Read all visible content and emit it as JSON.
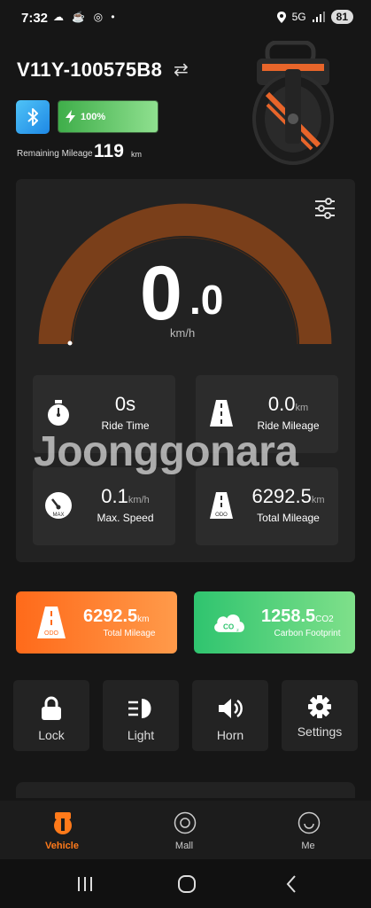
{
  "status_bar": {
    "time": "7:32",
    "notification_icons": "☁ ☕ ◎ •",
    "network": "5G",
    "battery": "81"
  },
  "vehicle": {
    "name": "V11Y-100575B8"
  },
  "battery": {
    "percent_label": "100%",
    "level": 1.0
  },
  "remaining": {
    "label": "Remaining Mileage",
    "value": "119",
    "unit": "km"
  },
  "speed": {
    "integer": "0",
    "decimal": ".0",
    "unit": "km/h"
  },
  "stats": [
    {
      "value": "0s",
      "unit": "",
      "label": "Ride Time",
      "icon": "stopwatch-icon"
    },
    {
      "value": "0.0",
      "unit": "km",
      "label": "Ride Mileage",
      "icon": "road-icon"
    },
    {
      "value": "0.1",
      "unit": "km/h",
      "label": "Max. Speed",
      "icon": "speedometer-icon"
    },
    {
      "value": "6292.5",
      "unit": "km",
      "label": "Total Mileage",
      "icon": "odometer-road-icon"
    }
  ],
  "watermark": "Joonggonara",
  "summary": [
    {
      "value": "6292.5",
      "unit": "km",
      "label": "Total Mileage",
      "color": "#ff6a1a"
    },
    {
      "value": "1258.5",
      "unit": "CO2",
      "label": "Carbon Footprint",
      "color": "#2fc46f"
    }
  ],
  "controls": [
    {
      "label": "Lock",
      "icon": "lock-icon"
    },
    {
      "label": "Light",
      "icon": "headlight-icon"
    },
    {
      "label": "Horn",
      "icon": "speaker-icon"
    },
    {
      "label": "Settings",
      "icon": "gear-icon"
    }
  ],
  "nav": [
    {
      "label": "Vehicle",
      "icon": "vehicle-icon",
      "active": true
    },
    {
      "label": "Mall",
      "icon": "mall-icon",
      "active": false
    },
    {
      "label": "Me",
      "icon": "me-icon",
      "active": false
    }
  ],
  "colors": {
    "accent": "#ff6a1a",
    "gauge_fill": "#7a3f1a",
    "green": "#2fc46f"
  }
}
